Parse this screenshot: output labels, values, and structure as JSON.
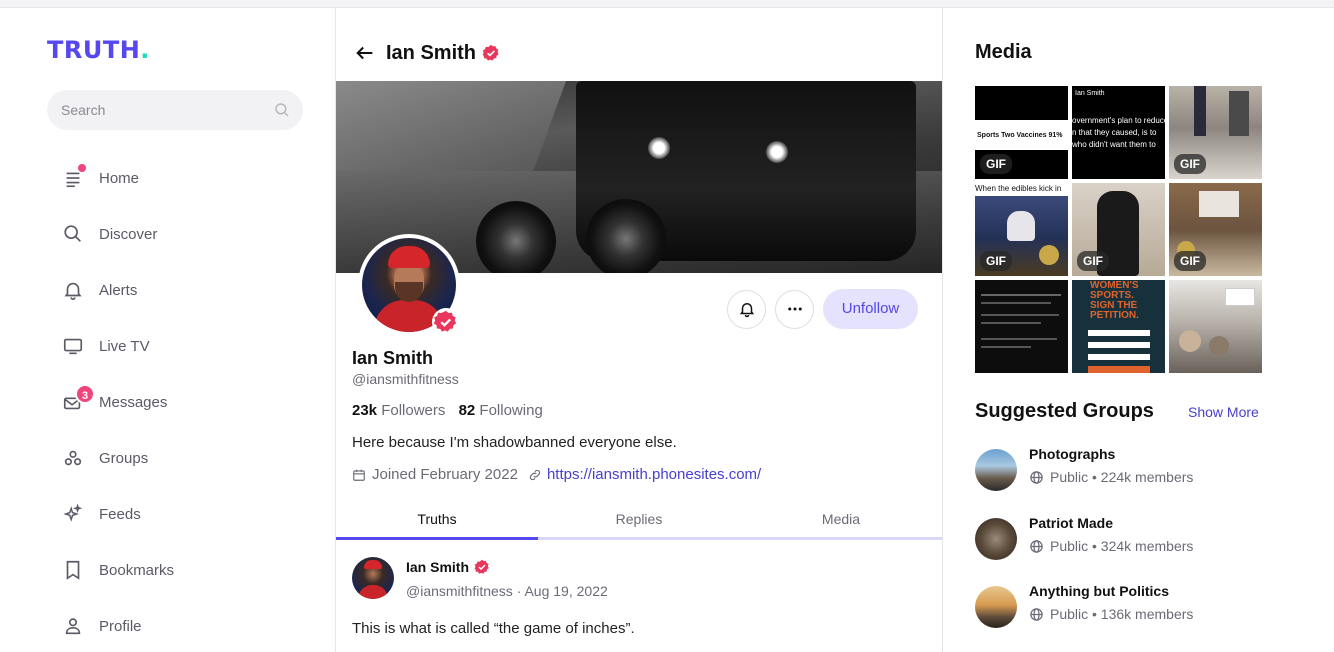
{
  "brand": {
    "name": "TRUTH",
    "dot": "."
  },
  "search": {
    "placeholder": "Search"
  },
  "nav": {
    "home": "Home",
    "discover": "Discover",
    "alerts": "Alerts",
    "live_tv": "Live TV",
    "messages": "Messages",
    "messages_badge": "3",
    "groups": "Groups",
    "feeds": "Feeds",
    "bookmarks": "Bookmarks",
    "profile": "Profile"
  },
  "header": {
    "title": "Ian Smith"
  },
  "profile": {
    "name": "Ian Smith",
    "handle": "@iansmithfitness",
    "followers_count": "23k",
    "followers_label": "Followers",
    "following_count": "82",
    "following_label": "Following",
    "bio": "Here because I'm shadowbanned everyone else.",
    "joined": "Joined February 2022",
    "website": "https://iansmith.phonesites.com/",
    "unfollow_label": "Unfollow"
  },
  "tabs": [
    "Truths",
    "Replies",
    "Media"
  ],
  "post": {
    "author": "Ian Smith",
    "meta": "@iansmithfitness · Aug 19, 2022",
    "text": "This is what is called “the game of inches”."
  },
  "media": {
    "title": "Media",
    "gif_label": "GIF",
    "tile_captions": {
      "t1": "Sports Two Vaccines 91%",
      "t2_line1": "Ian Smith",
      "t2_line2": "overnment's plan to reduce",
      "t2_line3": "n that they caused, is to",
      "t2_line4": "who didn't want them to",
      "t4": "When the edibles kick in",
      "t8_line1": "WOMEN'S",
      "t8_line2": "SPORTS.",
      "t8_line3": "SIGN THE",
      "t8_line4": "PETITION."
    }
  },
  "suggested_groups": {
    "title": "Suggested Groups",
    "show_more": "Show More",
    "items": [
      {
        "name": "Photographs",
        "meta": "Public • 224k members"
      },
      {
        "name": "Patriot Made",
        "meta": "Public • 324k members"
      },
      {
        "name": "Anything but Politics",
        "meta": "Public • 136k members"
      }
    ]
  },
  "colors": {
    "accent": "#5448ee",
    "brand_dot": "#17e0c0",
    "badge": "#f0447a",
    "verified": "#e8365d",
    "link": "#4640d0",
    "unfollow_bg": "#e4e2fd"
  }
}
